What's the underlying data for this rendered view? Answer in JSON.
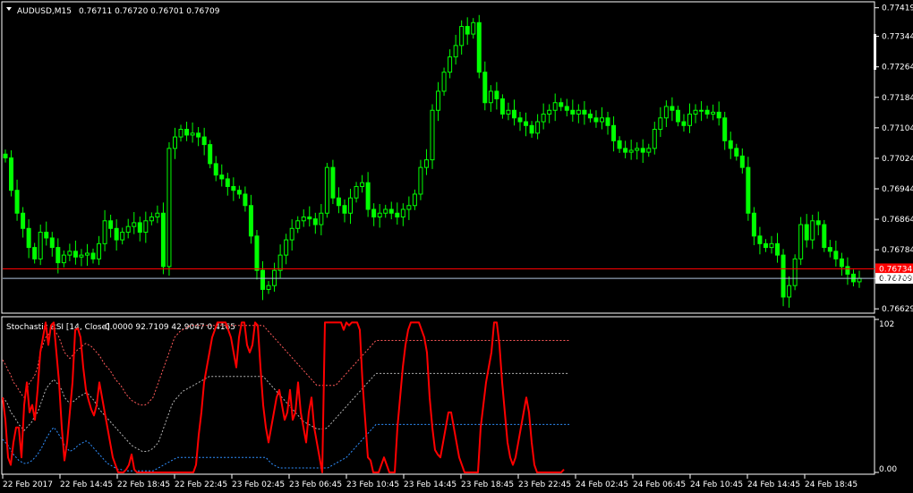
{
  "symbol_header": {
    "symbol": "AUDUSD,M15",
    "ohlc": "0.76711 0.76720 0.76701 0.76709"
  },
  "indicator_header": {
    "name": "Stochastic RSI [14, Close]",
    "values": "0.0000 92.7109 42.9047 0.4165"
  },
  "colors": {
    "background": "#000000",
    "candles": "#00ff00",
    "stoch_line": "#ff0000",
    "upper_band": "#ff5a5a",
    "middle_band": "#b4b4b4",
    "lower_band": "#2f8fff",
    "bid_line": "#ff0000",
    "last_line": "#b0c4de",
    "axes": "#ffffff"
  },
  "chart_data": [
    {
      "type": "candlestick",
      "series": [
        {
          "name": "AUDUSD,M15"
        }
      ],
      "y_ticks": [
        "0.77419",
        "0.77344",
        "0.77264",
        "0.77184",
        "0.77104",
        "0.77024",
        "0.76944",
        "0.76864",
        "0.76784",
        "0.76709",
        "0.76629"
      ],
      "y_tick_values": [
        0.77419,
        0.77344,
        0.77264,
        0.77184,
        0.77104,
        0.77024,
        0.76944,
        0.76864,
        0.76784,
        0.76709,
        0.76629
      ],
      "ylim": [
        0.7662,
        0.7743
      ],
      "price_labels": [
        {
          "value": 0.76734,
          "text": "0.76734",
          "role": "bid"
        },
        {
          "value": 0.76709,
          "text": "0.76709",
          "role": "last"
        }
      ],
      "x_ticks": [
        "22 Feb 2017",
        "22 Feb 14:45",
        "22 Feb 18:45",
        "22 Feb 22:45",
        "23 Feb 02:45",
        "23 Feb 06:45",
        "23 Feb 10:45",
        "23 Feb 14:45",
        "23 Feb 18:45",
        "23 Feb 22:45",
        "24 Feb 02:45",
        "24 Feb 06:45",
        "24 Feb 10:45",
        "24 Feb 14:45",
        "24 Feb 18:45"
      ],
      "closes": [
        0.77025,
        0.7694,
        0.7688,
        0.7684,
        0.7679,
        0.7676,
        0.7683,
        0.76815,
        0.7679,
        0.7675,
        0.7677,
        0.7678,
        0.76765,
        0.7677,
        0.76775,
        0.7676,
        0.768,
        0.7686,
        0.7684,
        0.7681,
        0.7683,
        0.76845,
        0.76855,
        0.7683,
        0.7686,
        0.7687,
        0.7688,
        0.7674,
        0.7705,
        0.7708,
        0.771,
        0.77085,
        0.7709,
        0.7708,
        0.7706,
        0.7701,
        0.7698,
        0.7697,
        0.7695,
        0.7694,
        0.7693,
        0.769,
        0.7682,
        0.7673,
        0.7668,
        0.7669,
        0.7673,
        0.7677,
        0.7681,
        0.7684,
        0.7686,
        0.7687,
        0.76865,
        0.7685,
        0.7688,
        0.77,
        0.7692,
        0.769,
        0.7688,
        0.7692,
        0.7695,
        0.7696,
        0.7689,
        0.7687,
        0.7688,
        0.7689,
        0.7688,
        0.7687,
        0.7689,
        0.769,
        0.7693,
        0.77,
        0.7702,
        0.7715,
        0.772,
        0.7725,
        0.7729,
        0.7732,
        0.7737,
        0.7735,
        0.7738,
        0.7725,
        0.7717,
        0.772,
        0.7718,
        0.7714,
        0.7715,
        0.7713,
        0.7712,
        0.7711,
        0.7709,
        0.7712,
        0.7714,
        0.7715,
        0.7717,
        0.7716,
        0.7715,
        0.7714,
        0.7715,
        0.7714,
        0.7713,
        0.7712,
        0.7713,
        0.7711,
        0.7707,
        0.7705,
        0.7704,
        0.77045,
        0.7705,
        0.7704,
        0.7705,
        0.771,
        0.7713,
        0.7716,
        0.7715,
        0.7712,
        0.7711,
        0.7714,
        0.7715,
        0.7715,
        0.7714,
        0.77145,
        0.7713,
        0.7707,
        0.7705,
        0.7703,
        0.77,
        0.7688,
        0.7682,
        0.768,
        0.7679,
        0.768,
        0.7677,
        0.7666,
        0.7669,
        0.7676,
        0.7685,
        0.7681,
        0.7686,
        0.7685,
        0.7679,
        0.7678,
        0.7676,
        0.7674,
        0.7672,
        0.767,
        0.76709
      ]
    },
    {
      "type": "line",
      "ylim": [
        0,
        102
      ],
      "y_ticks": [
        "102",
        "0.00"
      ],
      "y_tick_values": [
        102,
        0
      ],
      "x_start": 0,
      "x_step": 3,
      "series": [
        {
          "name": "",
          "values": [
            50,
            35,
            10,
            5,
            20,
            30,
            30,
            10,
            45,
            60,
            40,
            45,
            35,
            55,
            80,
            90,
            100,
            85,
            98,
            100,
            80,
            60,
            30,
            8,
            20,
            40,
            60,
            95,
            96,
            90,
            70,
            55,
            48,
            42,
            38,
            45,
            60,
            50,
            40,
            30,
            20,
            10,
            5,
            0,
            0,
            0,
            2,
            5,
            12,
            2,
            0,
            0,
            0,
            0,
            0,
            0,
            0,
            0,
            0,
            0,
            0,
            0,
            0,
            0,
            0,
            0,
            0,
            0,
            0,
            0,
            0,
            0,
            5,
            25,
            40,
            60,
            70,
            80,
            90,
            95,
            100,
            100,
            100,
            100,
            95,
            90,
            80,
            70,
            90,
            100,
            100,
            85,
            80,
            85,
            100,
            98,
            70,
            45,
            30,
            20,
            30,
            40,
            50,
            55,
            45,
            35,
            40,
            55,
            35,
            40,
            60,
            40,
            30,
            20,
            40,
            50,
            30,
            20,
            10,
            0,
            100,
            100,
            100,
            100,
            100,
            100,
            100,
            95,
            100,
            98,
            100,
            100,
            100,
            95,
            60,
            35,
            10,
            8,
            0,
            0,
            0,
            5,
            10,
            5,
            0,
            0,
            0,
            30,
            50,
            70,
            85,
            95,
            100,
            100,
            100,
            100,
            95,
            90,
            80,
            50,
            30,
            15,
            12,
            10,
            20,
            30,
            40,
            40,
            30,
            20,
            10,
            5,
            0,
            0,
            0,
            0,
            0,
            0,
            30,
            45,
            60,
            70,
            80,
            100,
            100,
            85,
            60,
            40,
            20,
            10,
            5,
            10,
            20,
            30,
            40,
            50,
            40,
            20,
            5,
            0,
            0,
            0,
            0,
            0,
            0,
            0,
            0,
            0,
            0,
            2
          ]
        },
        {
          "name": "",
          "values": [
            75,
            72,
            68,
            65,
            60,
            58,
            55,
            52,
            50,
            55,
            60,
            62,
            65,
            70,
            80,
            85,
            90,
            92,
            95,
            96,
            93,
            90,
            85,
            80,
            78,
            76,
            78,
            80,
            82,
            83,
            85,
            86,
            85,
            84,
            82,
            80,
            78,
            75,
            72,
            70,
            68,
            65,
            62,
            60,
            58,
            55,
            52,
            50,
            48,
            47,
            46,
            45,
            45,
            45,
            46,
            48,
            50,
            55,
            60,
            65,
            70,
            75,
            80,
            85,
            90,
            92,
            94,
            95,
            96,
            97,
            98,
            98,
            98,
            98,
            98,
            98,
            98,
            98,
            98,
            98,
            98,
            98,
            98,
            98,
            98,
            98,
            98,
            98,
            98,
            98,
            98,
            98,
            98,
            98,
            98,
            98,
            98,
            98,
            96,
            94,
            92,
            90,
            88,
            86,
            84,
            82,
            80,
            78,
            76,
            74,
            72,
            70,
            68,
            66,
            64,
            62,
            60,
            58,
            58,
            58,
            58,
            58,
            58,
            58,
            58,
            60,
            62,
            64,
            66,
            68,
            70,
            72,
            74,
            76,
            78,
            80,
            82,
            84,
            86,
            88,
            88,
            88,
            88,
            88,
            88,
            88,
            88,
            88,
            88,
            88,
            88,
            88,
            88,
            88,
            88,
            88,
            88,
            88,
            88,
            88,
            88,
            88,
            88,
            88,
            88,
            88,
            88,
            88,
            88,
            88,
            88,
            88,
            88,
            88,
            88,
            88,
            88,
            88,
            88,
            88,
            88,
            88,
            88,
            88,
            88,
            88,
            88,
            88,
            88,
            88,
            88,
            88,
            88,
            88,
            88,
            88,
            88,
            88,
            88,
            88,
            88,
            88,
            88,
            88,
            88,
            88,
            88,
            88,
            88,
            88,
            88,
            88
          ]
        },
        {
          "name": "",
          "values": [
            50,
            48,
            45,
            40,
            38,
            35,
            32,
            30,
            28,
            30,
            32,
            34,
            38,
            40,
            45,
            50,
            55,
            58,
            60,
            62,
            60,
            58,
            55,
            50,
            48,
            46,
            47,
            48,
            50,
            51,
            52,
            53,
            52,
            50,
            48,
            45,
            42,
            40,
            38,
            36,
            34,
            32,
            30,
            28,
            26,
            24,
            22,
            20,
            18,
            17,
            16,
            15,
            14,
            14,
            14,
            15,
            16,
            18,
            20,
            25,
            30,
            35,
            40,
            45,
            48,
            50,
            52,
            54,
            55,
            56,
            57,
            58,
            59,
            60,
            61,
            62,
            63,
            64,
            64,
            64,
            64,
            64,
            64,
            64,
            64,
            64,
            64,
            64,
            64,
            64,
            64,
            64,
            64,
            64,
            64,
            64,
            64,
            64,
            62,
            60,
            58,
            56,
            54,
            52,
            50,
            48,
            46,
            44,
            42,
            40,
            38,
            36,
            34,
            33,
            32,
            31,
            30,
            29,
            29,
            29,
            29,
            30,
            32,
            34,
            36,
            38,
            40,
            42,
            44,
            46,
            48,
            50,
            52,
            54,
            56,
            58,
            60,
            62,
            64,
            66,
            66,
            66,
            66,
            66,
            66,
            66,
            66,
            66,
            66,
            66,
            66,
            66,
            66,
            66,
            66,
            66,
            66,
            66,
            66,
            66,
            66,
            66,
            66,
            66,
            66,
            66,
            66,
            66,
            66,
            66,
            66,
            66,
            66,
            66,
            66,
            66,
            66,
            66,
            66,
            66,
            66,
            66,
            66,
            66,
            66,
            66,
            66,
            66,
            66,
            66,
            66,
            66,
            66,
            66,
            66,
            66,
            66,
            66,
            66,
            66,
            66,
            66,
            66,
            66,
            66,
            66,
            66,
            66,
            66,
            66,
            66,
            66
          ]
        },
        {
          "name": "",
          "values": [
            22,
            20,
            18,
            15,
            12,
            10,
            8,
            7,
            6,
            6,
            7,
            8,
            10,
            12,
            15,
            18,
            22,
            25,
            28,
            30,
            28,
            25,
            22,
            18,
            16,
            14,
            15,
            16,
            18,
            19,
            20,
            21,
            20,
            18,
            16,
            14,
            12,
            10,
            8,
            6,
            5,
            4,
            3,
            2,
            2,
            1,
            1,
            1,
            1,
            1,
            1,
            1,
            1,
            1,
            1,
            1,
            1,
            2,
            3,
            4,
            5,
            6,
            7,
            8,
            9,
            10,
            10,
            10,
            10,
            10,
            10,
            10,
            10,
            10,
            10,
            10,
            10,
            10,
            10,
            10,
            10,
            10,
            10,
            10,
            10,
            10,
            10,
            10,
            10,
            10,
            10,
            10,
            10,
            10,
            10,
            10,
            10,
            10,
            10,
            8,
            6,
            5,
            4,
            3,
            3,
            3,
            3,
            3,
            3,
            3,
            3,
            3,
            3,
            3,
            3,
            3,
            3,
            3,
            3,
            3,
            3,
            3,
            4,
            5,
            6,
            7,
            8,
            9,
            10,
            12,
            14,
            16,
            18,
            20,
            22,
            24,
            26,
            28,
            30,
            32,
            32,
            32,
            32,
            32,
            32,
            32,
            32,
            32,
            32,
            32,
            32,
            32,
            32,
            32,
            32,
            32,
            32,
            32,
            32,
            32,
            32,
            32,
            32,
            32,
            32,
            32,
            32,
            32,
            32,
            32,
            32,
            32,
            32,
            32,
            32,
            32,
            32,
            32,
            32,
            32,
            32,
            32,
            32,
            32,
            32,
            32,
            32,
            32,
            32,
            32,
            32,
            32,
            32,
            32,
            32,
            32,
            32,
            32,
            32,
            32,
            32,
            32,
            32,
            32,
            32,
            32,
            32,
            32,
            32,
            32,
            32,
            32
          ]
        }
      ]
    }
  ]
}
